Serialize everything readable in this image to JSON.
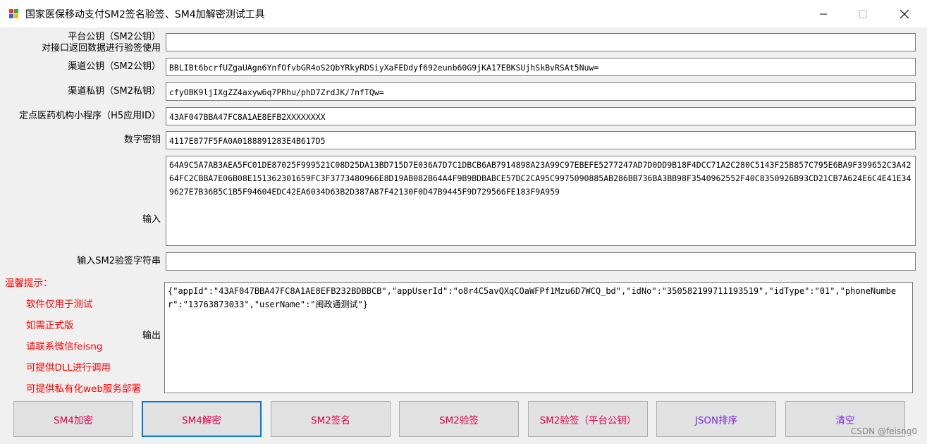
{
  "window": {
    "title": "国家医保移动支付SM2签名验签、SM4加解密测试工具",
    "controls": [
      "minimize",
      "maximize",
      "close"
    ]
  },
  "fields": {
    "platform_pubkey": {
      "label1": "平台公钥（SM2公钥）",
      "label2": "对接口返回数据进行验签使用",
      "value": ""
    },
    "channel_pubkey": {
      "label": "渠道公钥（SM2公钥）",
      "value": "BBLIBt6bcrfUZgaUAgn6YnfOfvbGR4oS2QbYRkyRDSiyXaFEDdyf692eunb60G9jKA17EBKSUjhSkBvRSAt5Nuw="
    },
    "channel_privkey": {
      "label": "渠道私钥（SM2私钥）",
      "value": "cfyOBK9ljIXgZZ4axyw6q7PRhu/phD7ZrdJK/7nfTQw="
    },
    "app_id": {
      "label": "定点医药机构小程序（H5应用ID）",
      "value": "43AF047BBA47FC8A1AE8EFB2XXXXXXXX"
    },
    "digital_key": {
      "label": "数字密钥",
      "value": "4117E877F5FA0A0188891283E4B617D5"
    },
    "input": {
      "label": "输入",
      "value": "64A9C5A7AB3AEA5FC01DE87025F999521C08D25DA13BD715D7E036A7D7C1DBCB6AB7914898A23A99C97EBEFE5277247AD7D0DD9B18F4DCC71A2C280C5143F25B857C795E6BA9F399652C3A4264FC2CBBA7E06B08E151362301659FC3F3773480966E8D19AB082B64A4F9B9BDBABCE57DC2CA95C9975090885AB286BB736BA3BB98F3540962552F40C8350926B93CD21CB7A624E6C4E41E349627E7B36B5C1B5F94604EDC42EA6034D63B2D387A87F42130F0D47B9445F9D729566FE183F9A959"
    },
    "sm2_verify_str": {
      "label": "输入SM2验签字符串",
      "value": ""
    },
    "output": {
      "label": "输出",
      "value": "{\"appId\":\"43AF047BBA47FC8A1AE8EFB232BDBBCB\",\"appUserId\":\"o8r4C5avQXqCOaWFPf1Mzu6D7WCQ_bd\",\"idNo\":\"350582199711193519\",\"idType\":\"01\",\"phoneNumber\":\"13763873033\",\"userName\":\"闽政通测试\"}"
    }
  },
  "notice": {
    "title": "温馨提示：",
    "lines": [
      "软件仅用于测试",
      "如需正式版",
      "请联系微信feisng",
      "可提供DLL进行调用",
      "可提供私有化web服务部署"
    ]
  },
  "buttons": {
    "sm4_encrypt": "SM4加密",
    "sm4_decrypt": "SM4解密",
    "sm2_sign": "SM2签名",
    "sm2_verify": "SM2验签",
    "sm2_verify_platform": "SM2验签（平台公钥）",
    "json_sort": "JSON排序",
    "clear": "清空"
  },
  "colors": {
    "button_text": "#e0004a",
    "button_text_purple": "#7b2be2",
    "notice_text": "#ff0000",
    "focus_border": "#0078d7"
  },
  "watermark": "CSDN @feisng0"
}
